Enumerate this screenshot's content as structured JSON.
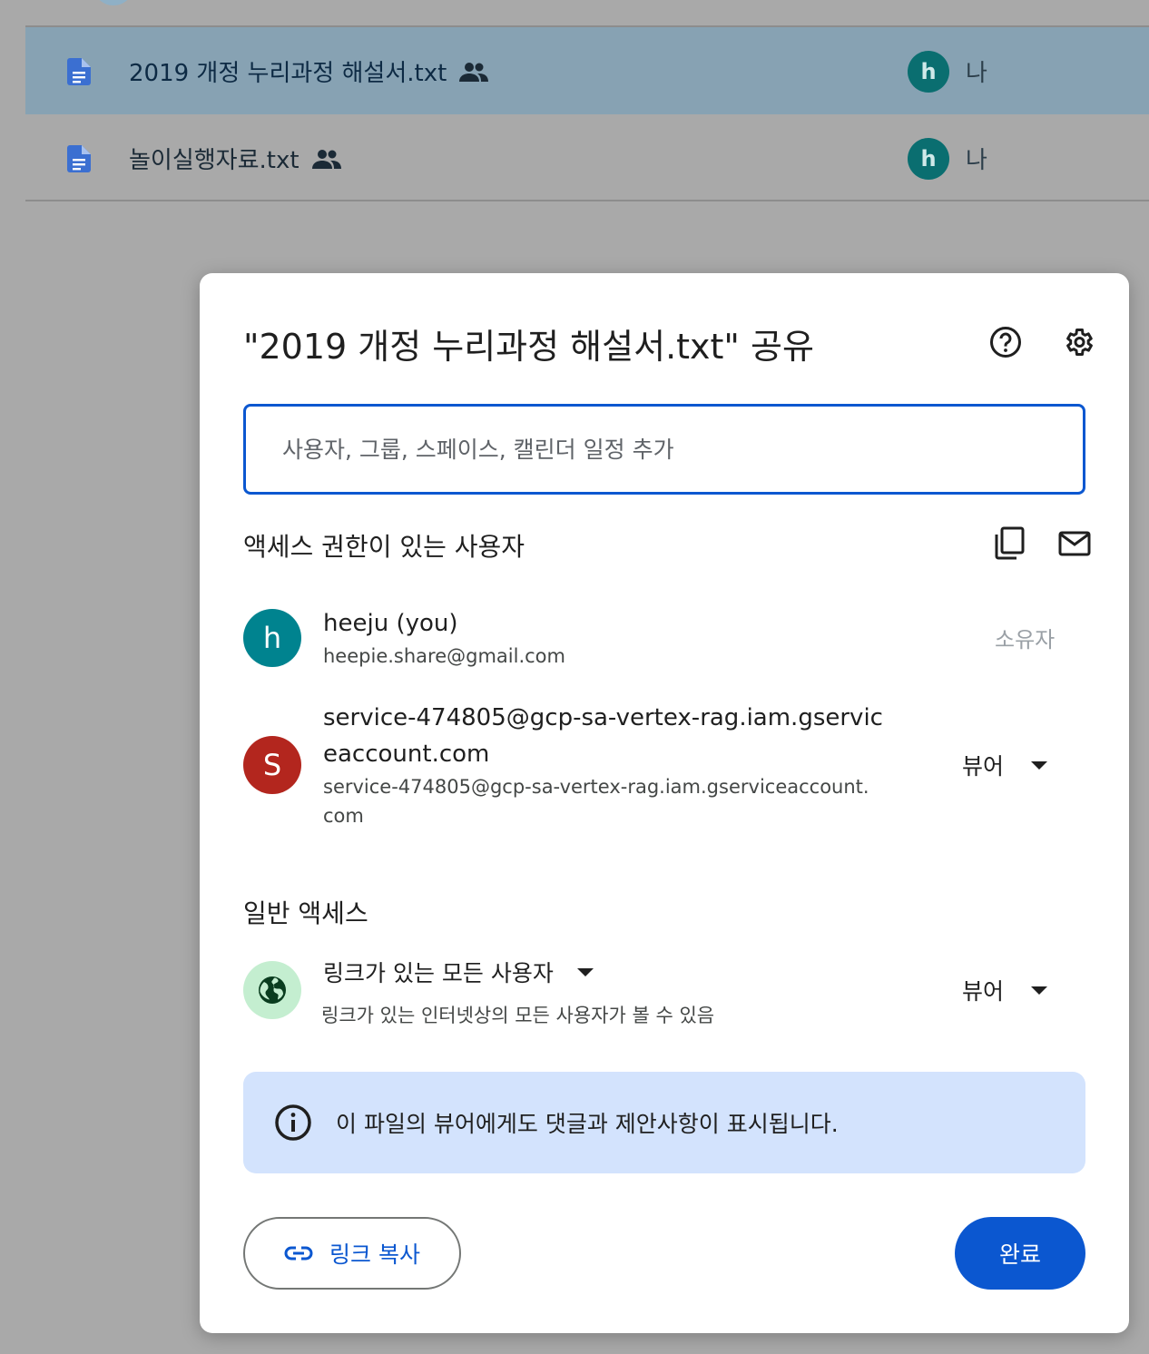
{
  "file_list": {
    "rows": [
      {
        "name": "2019 개정 누리과정 해설서.txt",
        "owner_initial": "h",
        "owner": "나",
        "selected": true
      },
      {
        "name": "놀이실행자료.txt",
        "owner_initial": "h",
        "owner": "나",
        "selected": false
      }
    ]
  },
  "dialog": {
    "title": "\"2019 개정 누리과정 해설서.txt\" 공유",
    "help_icon": "help-circle-icon",
    "settings_icon": "gear-icon",
    "search": {
      "placeholder": "사용자, 그룹, 스페이스, 캘린더 일정 추가",
      "value": ""
    },
    "people_section": {
      "title": "액세스 권한이 있는 사용자",
      "people": [
        {
          "initial": "h",
          "name": "heeju (you)",
          "email": "heepie.share@gmail.com",
          "role": "소유자",
          "avatar_color": "#00838f"
        },
        {
          "initial": "S",
          "name_line1": "service-474805@gcp-sa-vertex-rag.iam.gservic",
          "name_line2": "eaccount.com",
          "email_line1": "service-474805@gcp-sa-vertex-rag.iam.gserviceaccount.",
          "email_line2": "com",
          "role": "뷰어",
          "avatar_color": "#b3261e"
        }
      ]
    },
    "general_access": {
      "title": "일반 액세스",
      "scope": "링크가 있는 모든 사용자",
      "description": "링크가 있는 인터넷상의 모든 사용자가 볼 수 있음",
      "role": "뷰어"
    },
    "info": {
      "text": "이 파일의 뷰어에게도 댓글과 제안사항이 표시됩니다."
    },
    "copy_link_label": "링크 복사",
    "done_label": "완료"
  },
  "colors": {
    "accent": "#0b57d0",
    "info_bg": "#d3e3fd",
    "globe_bg": "#c4eed0"
  }
}
